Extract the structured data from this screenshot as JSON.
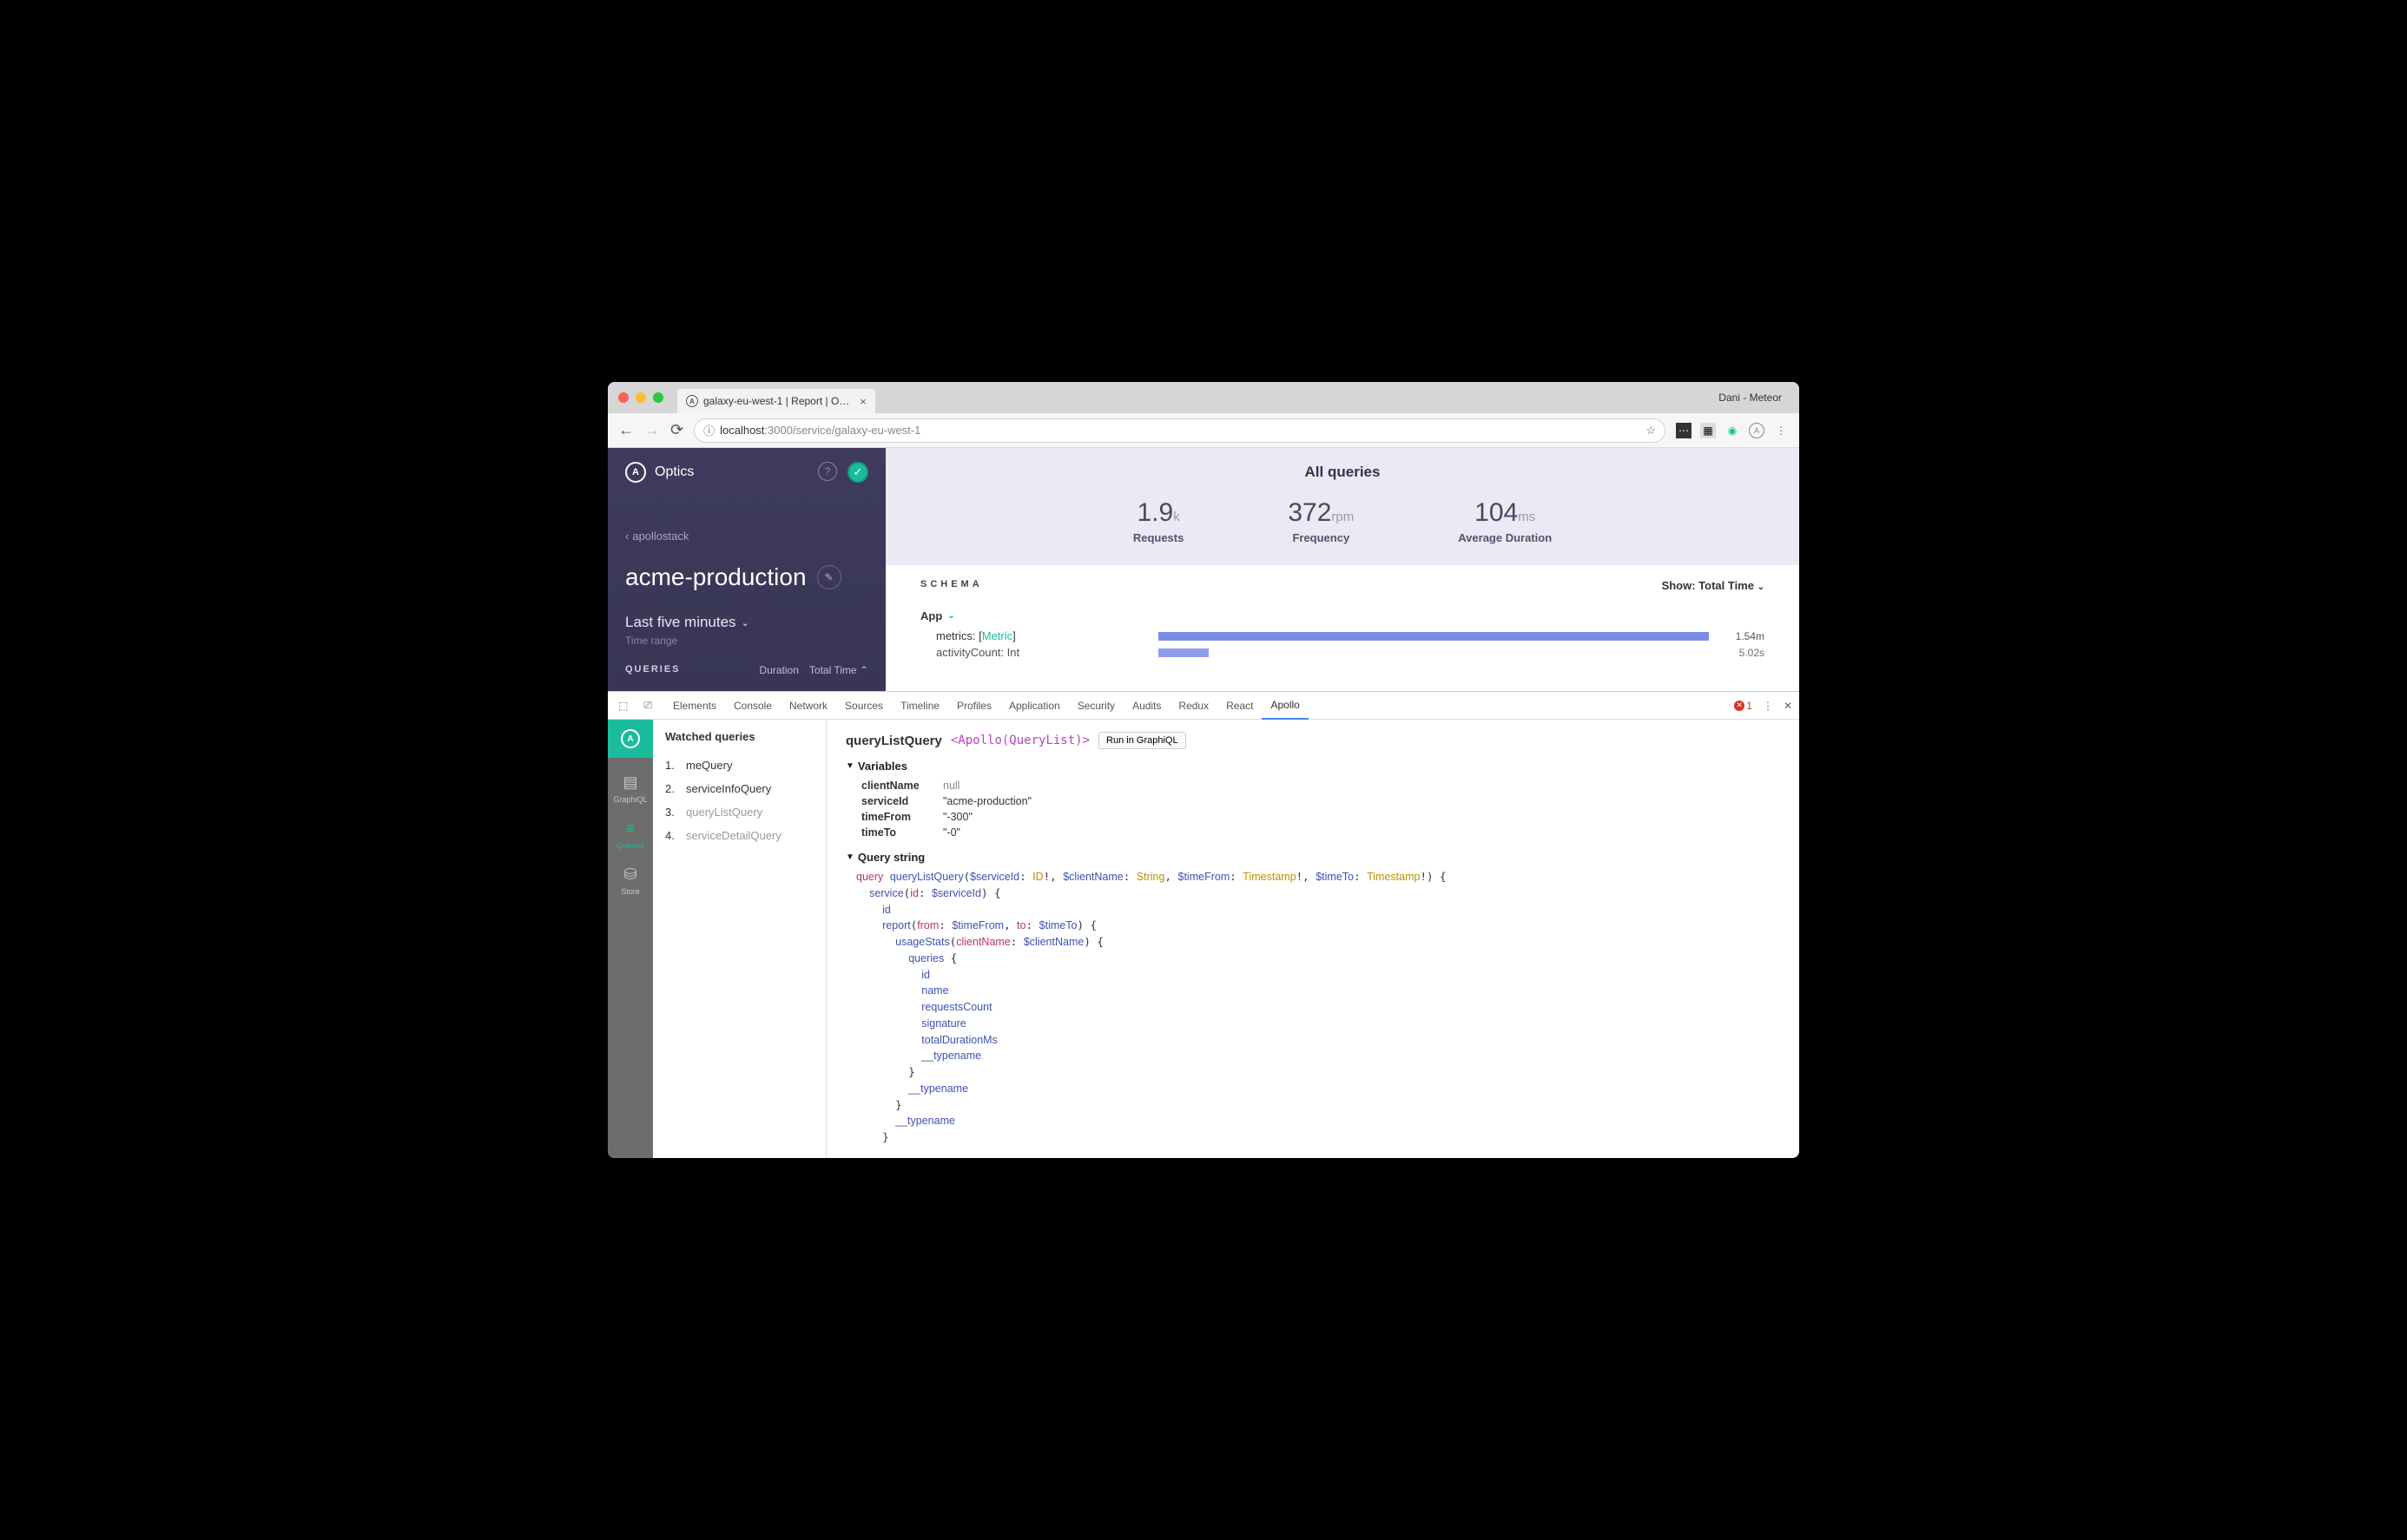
{
  "browser": {
    "tab_title": "galaxy-eu-west-1 | Report | O…",
    "profile": "Dani - Meteor",
    "url_host": "localhost",
    "url_port": ":3000",
    "url_path": "/service/galaxy-eu-west-1"
  },
  "sidebar": {
    "brand": "Optics",
    "breadcrumb": "apollostack",
    "service": "acme-production",
    "timerange": "Last five minutes",
    "timerange_label": "Time range",
    "queries_label": "QUERIES",
    "duration_label": "Duration",
    "sort_label": "Total Time"
  },
  "main": {
    "title": "All queries",
    "stats": [
      {
        "value": "1.9",
        "unit": "k",
        "label": "Requests"
      },
      {
        "value": "372",
        "unit": "rpm",
        "label": "Frequency"
      },
      {
        "value": "104",
        "unit": "ms",
        "label": "Average Duration"
      }
    ],
    "schema_label": "SCHEMA",
    "show_label": "Show: Total Time",
    "type_name": "App",
    "fields": [
      {
        "name": "metrics",
        "type": "Metric",
        "bracket": true,
        "bar": 100,
        "time": "1.54m"
      },
      {
        "name": "activityCount",
        "type": "Int",
        "bracket": false,
        "bar": 6,
        "time": "5.02s"
      }
    ]
  },
  "devtools": {
    "tabs": [
      "Elements",
      "Console",
      "Network",
      "Sources",
      "Timeline",
      "Profiles",
      "Application",
      "Security",
      "Audits",
      "Redux",
      "React",
      "Apollo"
    ],
    "active_tab": "Apollo",
    "error_count": "1",
    "rail": [
      {
        "label": "GraphiQL"
      },
      {
        "label": "Queries"
      },
      {
        "label": "Store"
      }
    ],
    "watched_label": "Watched queries",
    "queries": [
      {
        "n": "1.",
        "name": "meQuery",
        "dim": false
      },
      {
        "n": "2.",
        "name": "serviceInfoQuery",
        "dim": false
      },
      {
        "n": "3.",
        "name": "queryListQuery",
        "dim": true
      },
      {
        "n": "4.",
        "name": "serviceDetailQuery",
        "dim": true
      }
    ],
    "detail": {
      "name": "queryListQuery",
      "component": "<Apollo(QueryList)>",
      "run_btn": "Run in GraphiQL",
      "vars_label": "Variables",
      "vars": [
        {
          "k": "clientName",
          "v": "null",
          "null": true
        },
        {
          "k": "serviceId",
          "v": "\"acme-production\""
        },
        {
          "k": "timeFrom",
          "v": "\"-300\""
        },
        {
          "k": "timeTo",
          "v": "\"-0\""
        }
      ],
      "query_label": "Query string"
    }
  }
}
